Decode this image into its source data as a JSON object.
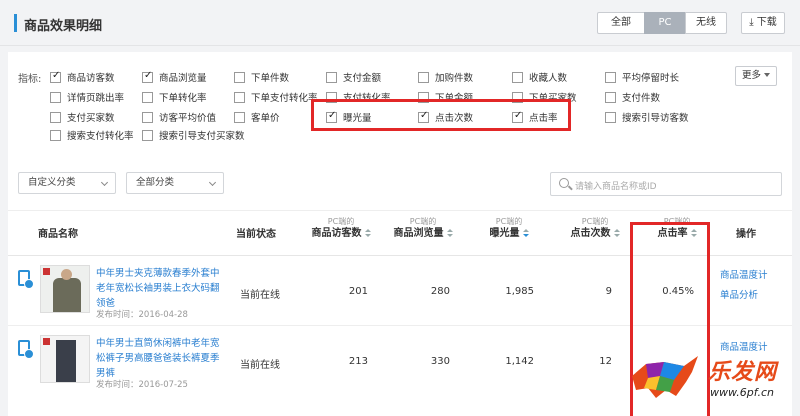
{
  "header": {
    "title": "商品效果明细",
    "segments": [
      "全部",
      "PC",
      "无线"
    ],
    "active_segment": "PC",
    "download_label": "下载"
  },
  "indicators": {
    "label": "指标:",
    "more_label": "更多",
    "items": [
      {
        "label": "商品访客数",
        "checked": true
      },
      {
        "label": "商品浏览量",
        "checked": true
      },
      {
        "label": "下单件数",
        "checked": false
      },
      {
        "label": "支付金额",
        "checked": false
      },
      {
        "label": "加购件数",
        "checked": false
      },
      {
        "label": "收藏人数",
        "checked": false
      },
      {
        "label": "平均停留时长",
        "checked": false
      },
      {
        "label": "详情页跳出率",
        "checked": false
      },
      {
        "label": "下单转化率",
        "checked": false
      },
      {
        "label": "下单支付转化率",
        "checked": false
      },
      {
        "label": "支付转化率",
        "checked": false
      },
      {
        "label": "下单金额",
        "checked": false
      },
      {
        "label": "下单买家数",
        "checked": false
      },
      {
        "label": "支付件数",
        "checked": false
      },
      {
        "label": "支付买家数",
        "checked": false
      },
      {
        "label": "访客平均价值",
        "checked": false
      },
      {
        "label": "客单价",
        "checked": false
      },
      {
        "label": "曝光量",
        "checked": true
      },
      {
        "label": "点击次数",
        "checked": true
      },
      {
        "label": "点击率",
        "checked": true
      },
      {
        "label": "搜索引导访客数",
        "checked": false
      },
      {
        "label": "搜索支付转化率",
        "checked": false
      },
      {
        "label": "搜索引导支付买家数",
        "checked": false
      }
    ]
  },
  "filters": {
    "custom_category": "自定义分类",
    "all_category": "全部分类",
    "search_placeholder": "请输入商品名称或ID"
  },
  "table": {
    "col_name": "商品名称",
    "col_status": "当前状态",
    "prefix": "PC端的",
    "metric_cols": [
      "商品访客数",
      "商品浏览量",
      "曝光量",
      "点击次数",
      "点击率"
    ],
    "col_action": "操作",
    "rows": [
      {
        "name": "中年男士夹克薄款春季外套中老年宽松长袖男装上衣大码翻领爸",
        "date": "发布时间：2016-04-28",
        "status": "当前在线",
        "visitors": "201",
        "views": "280",
        "exposure": "1,985",
        "clicks": "9",
        "ctr": "0.45%",
        "actions": [
          "商品温度计",
          "单品分析"
        ]
      },
      {
        "name": "中年男士直筒休闲裤中老年宽松裤子男高腰爸爸装长裤夏季男裤",
        "date": "发布时间：2016-07-25",
        "status": "当前在线",
        "visitors": "213",
        "views": "330",
        "exposure": "1,142",
        "clicks": "12",
        "ctr": "",
        "actions": [
          "商品温度计"
        ]
      }
    ]
  },
  "watermark": {
    "brand": "乐发网",
    "url": "www.6pf.cn"
  },
  "colors": {
    "accent": "#2a8fd6",
    "highlight": "#e22727"
  }
}
